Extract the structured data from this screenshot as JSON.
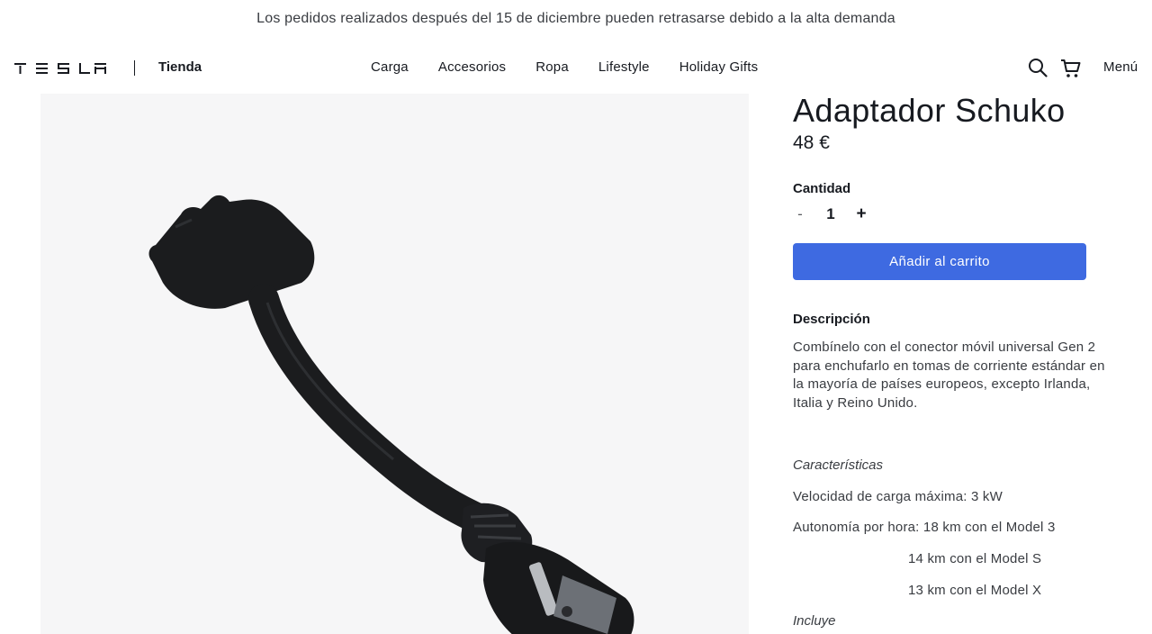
{
  "banner": {
    "text": "Los pedidos realizados después del 15 de diciembre pueden retrasarse debido a la alta demanda"
  },
  "header": {
    "store_label": "Tienda",
    "nav": [
      "Carga",
      "Accesorios",
      "Ropa",
      "Lifestyle",
      "Holiday Gifts"
    ],
    "menu_label": "Menú"
  },
  "product": {
    "title": "Adaptador Schuko",
    "price": "48 €",
    "quantity_label": "Cantidad",
    "quantity_minus": "-",
    "quantity_value": "1",
    "quantity_plus": "+",
    "add_to_cart_label": "Añadir al carrito",
    "description_label": "Descripción",
    "description": "Combínelo con el conector móvil universal Gen 2 para enchufarlo en tomas de corriente estándar en la mayoría de países europeos, excepto Irlanda, Italia y Reino Unido.",
    "features_label": "Características",
    "specs": [
      "Velocidad de carga máxima: 3 kW",
      "Autonomía por hora: 18 km con el Model 3",
      "14 km con el Model S",
      "13 km con el Model X"
    ],
    "includes_label": "Incluye"
  },
  "colors": {
    "accent": "#3e6ae1",
    "text": "#171a20",
    "muted": "#393c41",
    "image_bg": "#f6f6f7"
  }
}
